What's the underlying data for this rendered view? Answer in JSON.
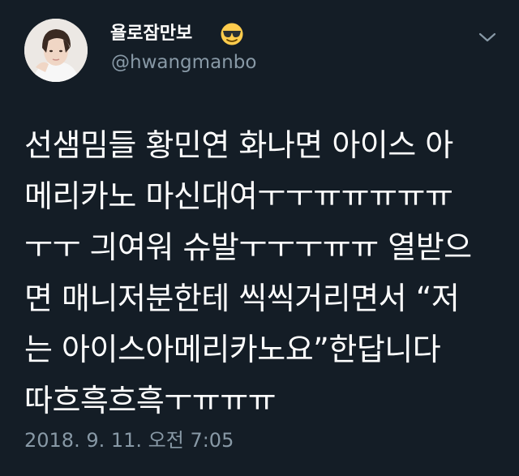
{
  "tweet": {
    "display_name": "욜로잠만보",
    "handle": "@hwangmanbo",
    "name_emoji": "smiling-face-with-sunglasses-icon",
    "body_lines": [
      "선샘밈들 황민연 화나면 아이스 아",
      "메리카노 마신대여ㅜㅜㅠㅠㅠㅠㅠ",
      "ㅜㅜ 긔여워 슈발ㅜㅜㅜㅠㅠ 열받으",
      "면 매니저분한테 씩씩거리면서 “저",
      "는 아이스아메리카노요”한답니다",
      "따흐흑흐흑ㅜㅠㅠㅠ"
    ],
    "timestamp": "2018. 9. 11. 오전 7:05"
  },
  "colors": {
    "background": "#141d26",
    "text_primary": "#ffffff",
    "text_secondary": "#8899a6"
  }
}
